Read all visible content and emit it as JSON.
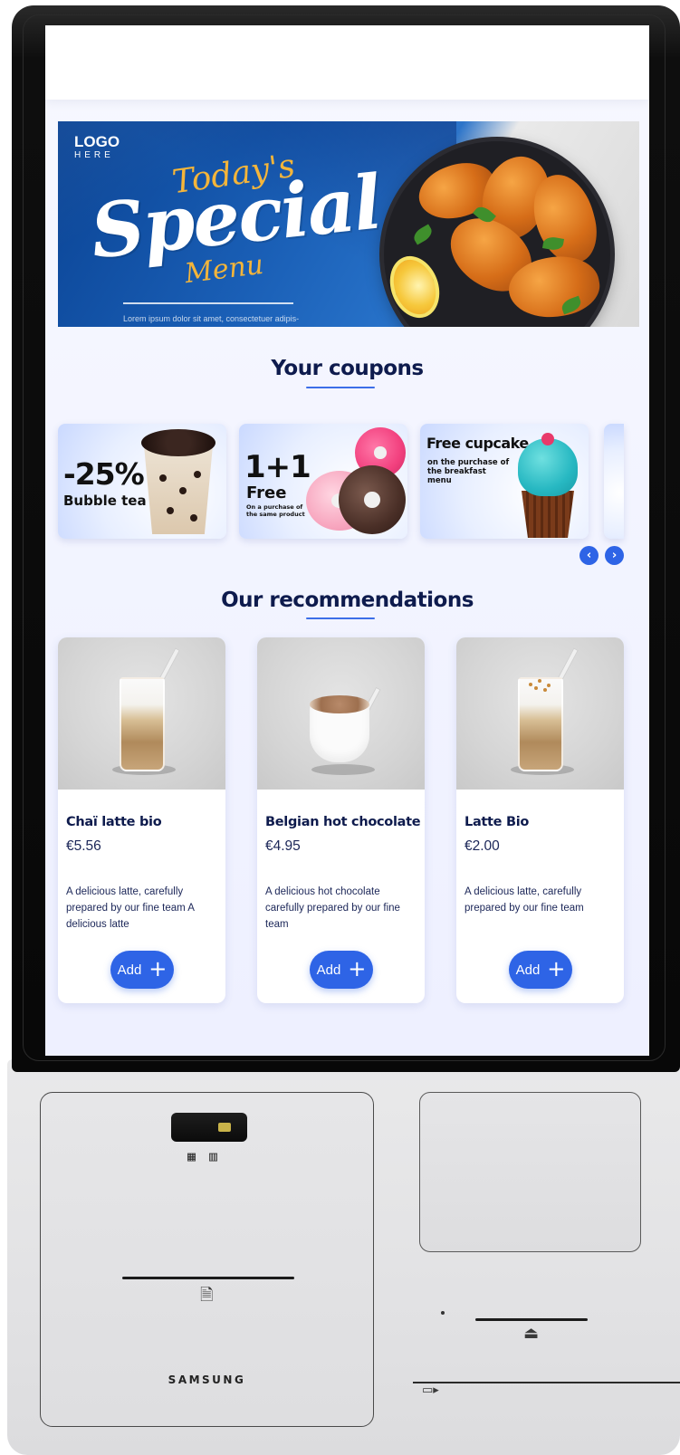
{
  "banner": {
    "logo_line1": "LOGO",
    "logo_line2": "HERE",
    "title_top": "Today's",
    "title_main": "Special",
    "title_bottom": "Menu",
    "caption": "Lorem ipsum dolor sit amet, consectetuer adipis-"
  },
  "coupons": {
    "title": "Your coupons",
    "items": [
      {
        "big": "-25%",
        "small": "Bubble tea"
      },
      {
        "big": "1+1",
        "mid": "Free",
        "small": "On a purchase of the same product"
      },
      {
        "big": "Free cupcake",
        "small": "on the purchase of the breakfast menu"
      }
    ],
    "prev_icon": "‹",
    "next_icon": "›"
  },
  "recommendations": {
    "title": "Our recommendations",
    "add_label": "Add",
    "add_icon": "+",
    "products": [
      {
        "name": "Chaï latte bio",
        "price": "€5.56",
        "description": "A delicious latte, carefully prepared by our fine team A delicious latte"
      },
      {
        "name": "Belgian hot chocolate",
        "price": "€4.95",
        "description": "A delicious hot chocolate carefully prepared by our fine team"
      },
      {
        "name": "Latte Bio",
        "price": "€2.00",
        "description": "A delicious latte, carefully prepared by our fine team"
      }
    ]
  },
  "kiosk": {
    "brand": "SAMSUNG",
    "scanner_icons": "▦ ▥",
    "receipt_icon": "🗎",
    "card_icon": "⏏",
    "nfc_icon": "▭▸"
  },
  "colors": {
    "accent": "#2e64e6",
    "title_text": "#0e1b4d",
    "background": "#eef0ff"
  }
}
